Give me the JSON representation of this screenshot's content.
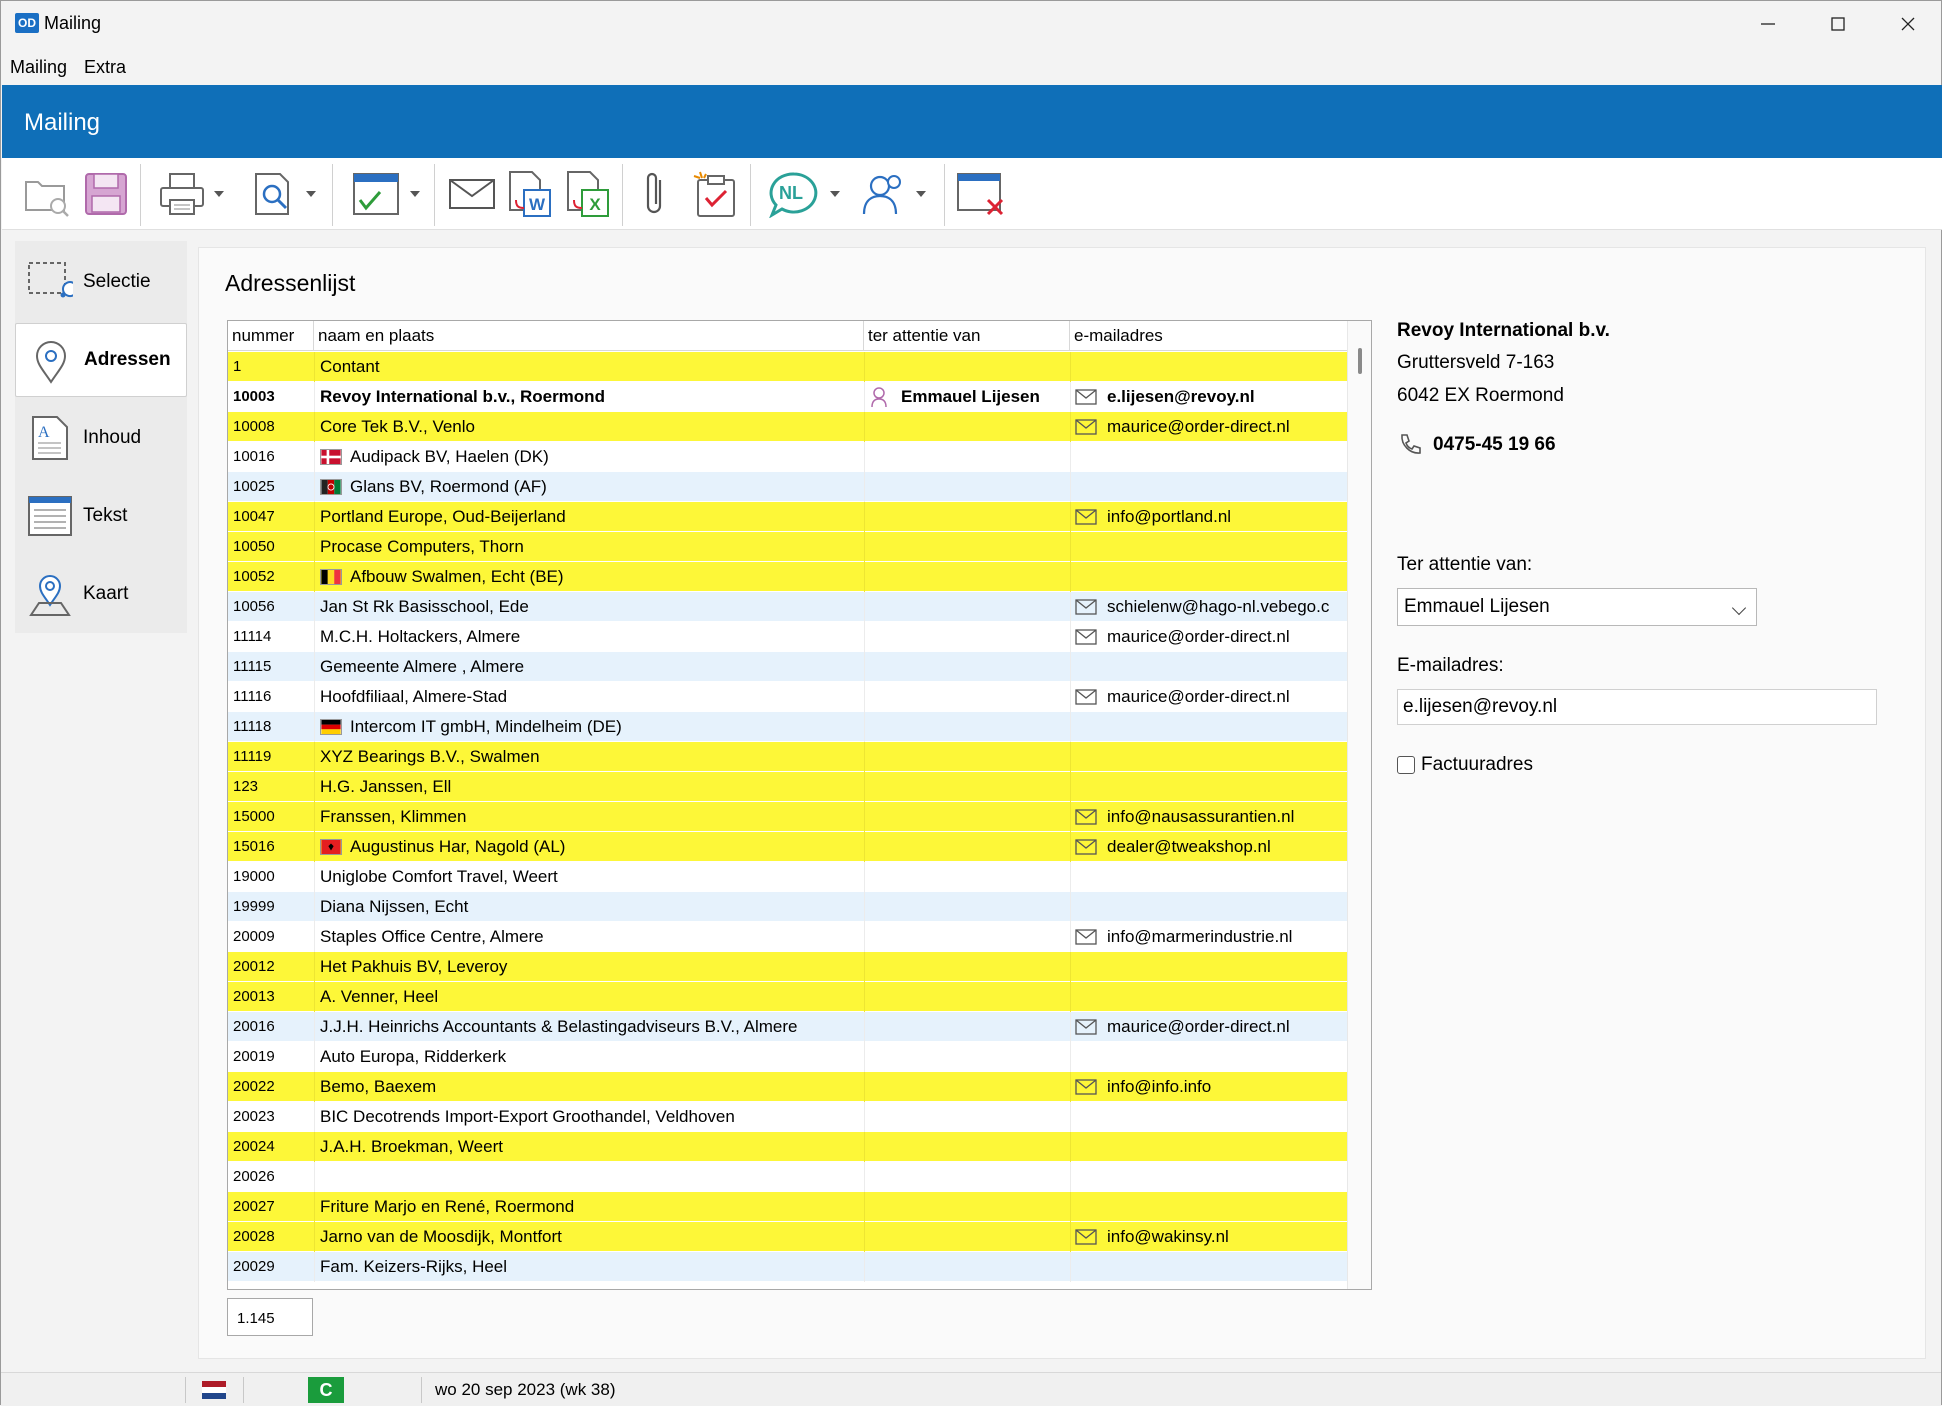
{
  "window": {
    "title": "Mailing",
    "logo": "OD"
  },
  "menu": [
    {
      "label": "Mailing"
    },
    {
      "label": "Extra"
    }
  ],
  "header": {
    "title": "Mailing"
  },
  "toolbar": {
    "language_badge": "NL"
  },
  "sidenav": [
    {
      "label": "Selectie",
      "icon": "selection-icon",
      "active": false
    },
    {
      "label": "Adressen",
      "icon": "map-pin-icon",
      "active": true
    },
    {
      "label": "Inhoud",
      "icon": "document-icon",
      "active": false
    },
    {
      "label": "Tekst",
      "icon": "text-lines-icon",
      "active": false
    },
    {
      "label": "Kaart",
      "icon": "map-icon",
      "active": false
    }
  ],
  "main": {
    "title": "Adressenlijst",
    "columns": [
      "nummer",
      "naam en plaats",
      "ter attentie van",
      "e-mailadres"
    ],
    "rows": [
      {
        "num": "1",
        "name": "Contant",
        "att": "",
        "mail": "",
        "bg": "yellow"
      },
      {
        "num": "10003",
        "name": "Revoy International b.v., Roermond",
        "att": "Emmauel Lijesen",
        "mail": "e.lijesen@revoy.nl",
        "bg": "white",
        "bold": true
      },
      {
        "num": "10008",
        "name": "Core Tek B.V., Venlo",
        "att": "",
        "mail": "maurice@order-direct.nl",
        "bg": "yellow"
      },
      {
        "num": "10016",
        "name": "Audipack BV, Haelen (DK)",
        "att": "",
        "mail": "",
        "bg": "white",
        "flag": "dk"
      },
      {
        "num": "10025",
        "name": "Glans BV, Roermond (AF)",
        "att": "",
        "mail": "",
        "bg": "blue",
        "flag": "af"
      },
      {
        "num": "10047",
        "name": "Portland Europe, Oud-Beijerland",
        "att": "",
        "mail": "info@portland.nl",
        "bg": "yellow"
      },
      {
        "num": "10050",
        "name": "Procase Computers, Thorn",
        "att": "",
        "mail": "",
        "bg": "yellow"
      },
      {
        "num": "10052",
        "name": "Afbouw Swalmen, Echt (BE)",
        "att": "",
        "mail": "",
        "bg": "yellow",
        "flag": "be"
      },
      {
        "num": "10056",
        "name": "Jan St Rk Basisschool, Ede",
        "att": "",
        "mail": "schielenw@hago-nl.vebego.c",
        "bg": "blue"
      },
      {
        "num": "11114",
        "name": "M.C.H. Holtackers, Almere",
        "att": "",
        "mail": "maurice@order-direct.nl",
        "bg": "white"
      },
      {
        "num": "11115",
        "name": "Gemeente Almere , Almere",
        "att": "",
        "mail": "",
        "bg": "blue"
      },
      {
        "num": "11116",
        "name": "Hoofdfiliaal, Almere-Stad",
        "att": "",
        "mail": "maurice@order-direct.nl",
        "bg": "white"
      },
      {
        "num": "11118",
        "name": "Intercom IT gmbH, Mindelheim (DE)",
        "att": "",
        "mail": "",
        "bg": "blue",
        "flag": "de"
      },
      {
        "num": "11119",
        "name": "XYZ Bearings B.V., Swalmen",
        "att": "",
        "mail": "",
        "bg": "yellow"
      },
      {
        "num": "123",
        "name": "H.G. Janssen, Ell",
        "att": "",
        "mail": "",
        "bg": "yellow"
      },
      {
        "num": "15000",
        "name": "Franssen, Klimmen",
        "att": "",
        "mail": "info@nausassurantien.nl",
        "bg": "yellow"
      },
      {
        "num": "15016",
        "name": "Augustinus Har, Nagold (AL)",
        "att": "",
        "mail": "dealer@tweakshop.nl",
        "bg": "yellow",
        "flag": "al"
      },
      {
        "num": "19000",
        "name": "Uniglobe Comfort Travel, Weert",
        "att": "",
        "mail": "",
        "bg": "white"
      },
      {
        "num": "19999",
        "name": "Diana Nijssen, Echt",
        "att": "",
        "mail": "",
        "bg": "blue"
      },
      {
        "num": "20009",
        "name": "Staples Office Centre, Almere",
        "att": "",
        "mail": "info@marmerindustrie.nl",
        "bg": "white"
      },
      {
        "num": "20012",
        "name": "Het Pakhuis BV, Leveroy",
        "att": "",
        "mail": "",
        "bg": "yellow"
      },
      {
        "num": "20013",
        "name": "A. Venner, Heel",
        "att": "",
        "mail": "",
        "bg": "yellow"
      },
      {
        "num": "20016",
        "name": "J.J.H. Heinrichs Accountants & Belastingadviseurs B.V., Almere",
        "att": "",
        "mail": "maurice@order-direct.nl",
        "bg": "blue"
      },
      {
        "num": "20019",
        "name": "Auto Europa, Ridderkerk",
        "att": "",
        "mail": "",
        "bg": "white"
      },
      {
        "num": "20022",
        "name": "Bemo, Baexem",
        "att": "",
        "mail": "info@info.info",
        "bg": "yellow"
      },
      {
        "num": "20023",
        "name": "BIC Decotrends Import-Export Groothandel, Veldhoven",
        "att": "",
        "mail": "",
        "bg": "white"
      },
      {
        "num": "20024",
        "name": "J.A.H. Broekman, Weert",
        "att": "",
        "mail": "",
        "bg": "yellow"
      },
      {
        "num": "20026",
        "name": "",
        "att": "",
        "mail": "",
        "bg": "white"
      },
      {
        "num": "20027",
        "name": "Friture Marjo en René, Roermond",
        "att": "",
        "mail": "",
        "bg": "yellow"
      },
      {
        "num": "20028",
        "name": "Jarno van de Moosdijk, Montfort",
        "att": "",
        "mail": "info@wakinsy.nl",
        "bg": "yellow"
      },
      {
        "num": "20029",
        "name": "Fam. Keizers-Rijks, Heel",
        "att": "",
        "mail": "",
        "bg": "blue"
      }
    ],
    "count": "1.145"
  },
  "detail": {
    "company": "Revoy International b.v.",
    "street": "Gruttersveld 7-163",
    "city": "6042 EX  Roermond",
    "phone": "0475-45 19 66",
    "attention_label": "Ter attentie van:",
    "attention_value": "Emmauel Lijesen",
    "email_label": "E-mailadres:",
    "email_value": "e.lijesen@revoy.nl",
    "invoice_label": "Factuuradres",
    "invoice_checked": false
  },
  "status": {
    "flag": "nl",
    "badge": "C",
    "date": "wo 20 sep 2023 (wk 38)"
  }
}
